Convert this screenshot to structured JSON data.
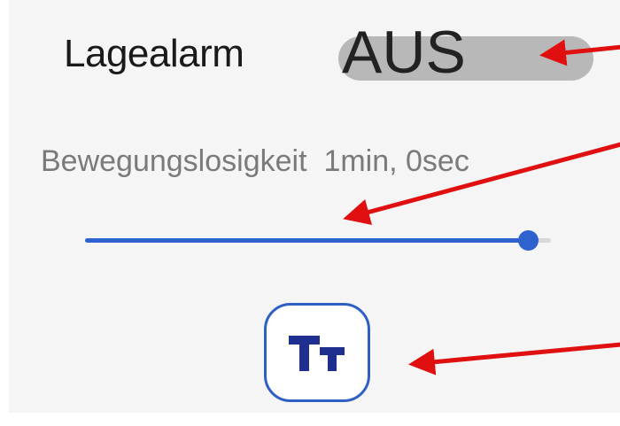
{
  "setting": {
    "label": "Lagealarm",
    "toggle_state": "AUS",
    "toggle_on": false
  },
  "inactivity": {
    "label": "Bewegungslosigkeit",
    "value": "1min, 0sec",
    "slider_fraction": 0.95
  },
  "text_size_button": {
    "icon": "text-size-icon"
  },
  "colors": {
    "accent": "#2d62cf",
    "annotation_arrow": "#e01010",
    "toggle_track": "#b8b8b8",
    "background": "#f5f5f5"
  }
}
